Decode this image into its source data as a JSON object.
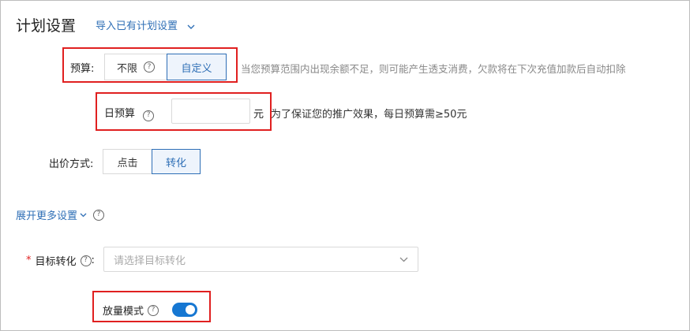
{
  "header": {
    "title": "计划设置",
    "import_link": "导入已有计划设置"
  },
  "budget": {
    "label": "预算:",
    "options": [
      "不限",
      "自定义"
    ],
    "selected": "自定义",
    "hint": "当您预算范围内出现余额不足，则可能产生透支消费，欠款将在下次充值加款后自动扣除"
  },
  "daily_budget": {
    "label": "日预算",
    "value": "",
    "unit": "元",
    "hint": "为了保证您的推广效果，每日预算需≥50元"
  },
  "bid_method": {
    "label": "出价方式:",
    "options": [
      "点击",
      "转化"
    ],
    "selected": "转化"
  },
  "more_settings": {
    "label": "展开更多设置"
  },
  "target_conversion": {
    "required_mark": "*",
    "label": "目标转化",
    "colon": ":",
    "placeholder": "请选择目标转化"
  },
  "volume_mode": {
    "label": "放量模式",
    "enabled": true
  },
  "colors": {
    "accent": "#2f6fb6",
    "toggle": "#1677d2",
    "highlight_box": "#e02020"
  }
}
